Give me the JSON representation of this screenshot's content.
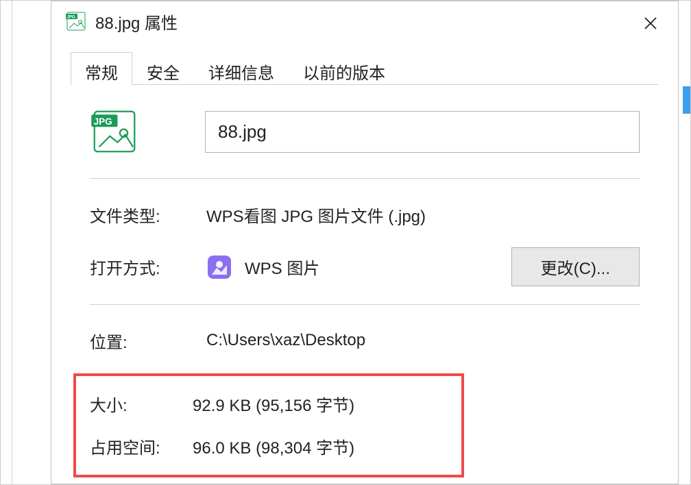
{
  "titlebar": {
    "title": "88.jpg 属性"
  },
  "tabs": {
    "general": "常规",
    "security": "安全",
    "details": "详细信息",
    "previous_versions": "以前的版本"
  },
  "filename": "88.jpg",
  "fields": {
    "filetype_label": "文件类型:",
    "filetype_value": "WPS看图 JPG 图片文件 (.jpg)",
    "openwith_label": "打开方式:",
    "openwith_value": "WPS 图片",
    "change_button": "更改(C)...",
    "location_label": "位置:",
    "location_value": "C:\\Users\\xaz\\Desktop",
    "size_label": "大小:",
    "size_value": "92.9 KB (95,156 字节)",
    "sizeondisk_label": "占用空间:",
    "sizeondisk_value": "96.0 KB (98,304 字节)"
  }
}
